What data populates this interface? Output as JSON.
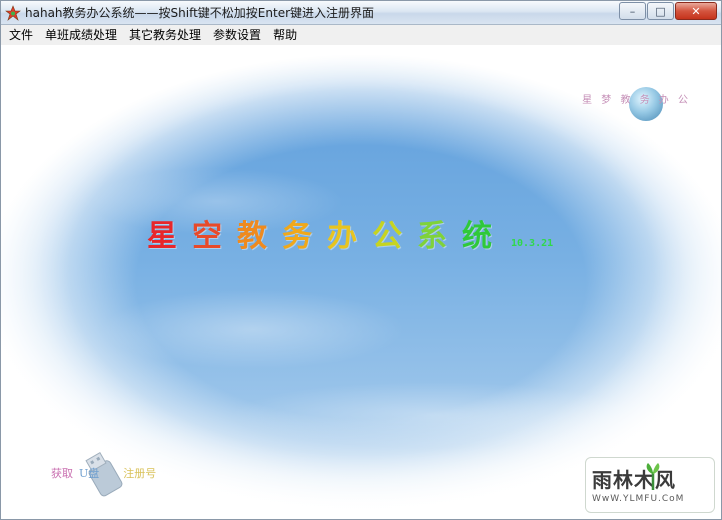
{
  "window": {
    "title": "hahah教务办公系统——按Shift键不松加按Enter键进入注册界面",
    "minimize_symbol": "–",
    "maximize_symbol": "□",
    "close_symbol": "✕",
    "icon": "app-icon"
  },
  "menu": {
    "items": [
      "文件",
      "单班成绩处理",
      "其它教务处理",
      "参数设置",
      "帮助"
    ]
  },
  "splash": {
    "title_chars": [
      "星",
      "空",
      "教",
      "务",
      "办",
      "公",
      "系",
      "统"
    ],
    "title_colors": [
      "#e8262a",
      "#e84a2a",
      "#ef8a1e",
      "#f0a81a",
      "#e8c41e",
      "#c6d421",
      "#7fd23a",
      "#2fc93a"
    ],
    "version": "10.3.21",
    "top_right_text": "星  梦  教  务  办  公",
    "bottom_left_left": "获取",
    "bottom_left_mid": "U盘",
    "bottom_left_right": "注册号"
  },
  "watermark": {
    "main": "雨林木风",
    "sub": "WwW.YLMFU.CoM"
  }
}
